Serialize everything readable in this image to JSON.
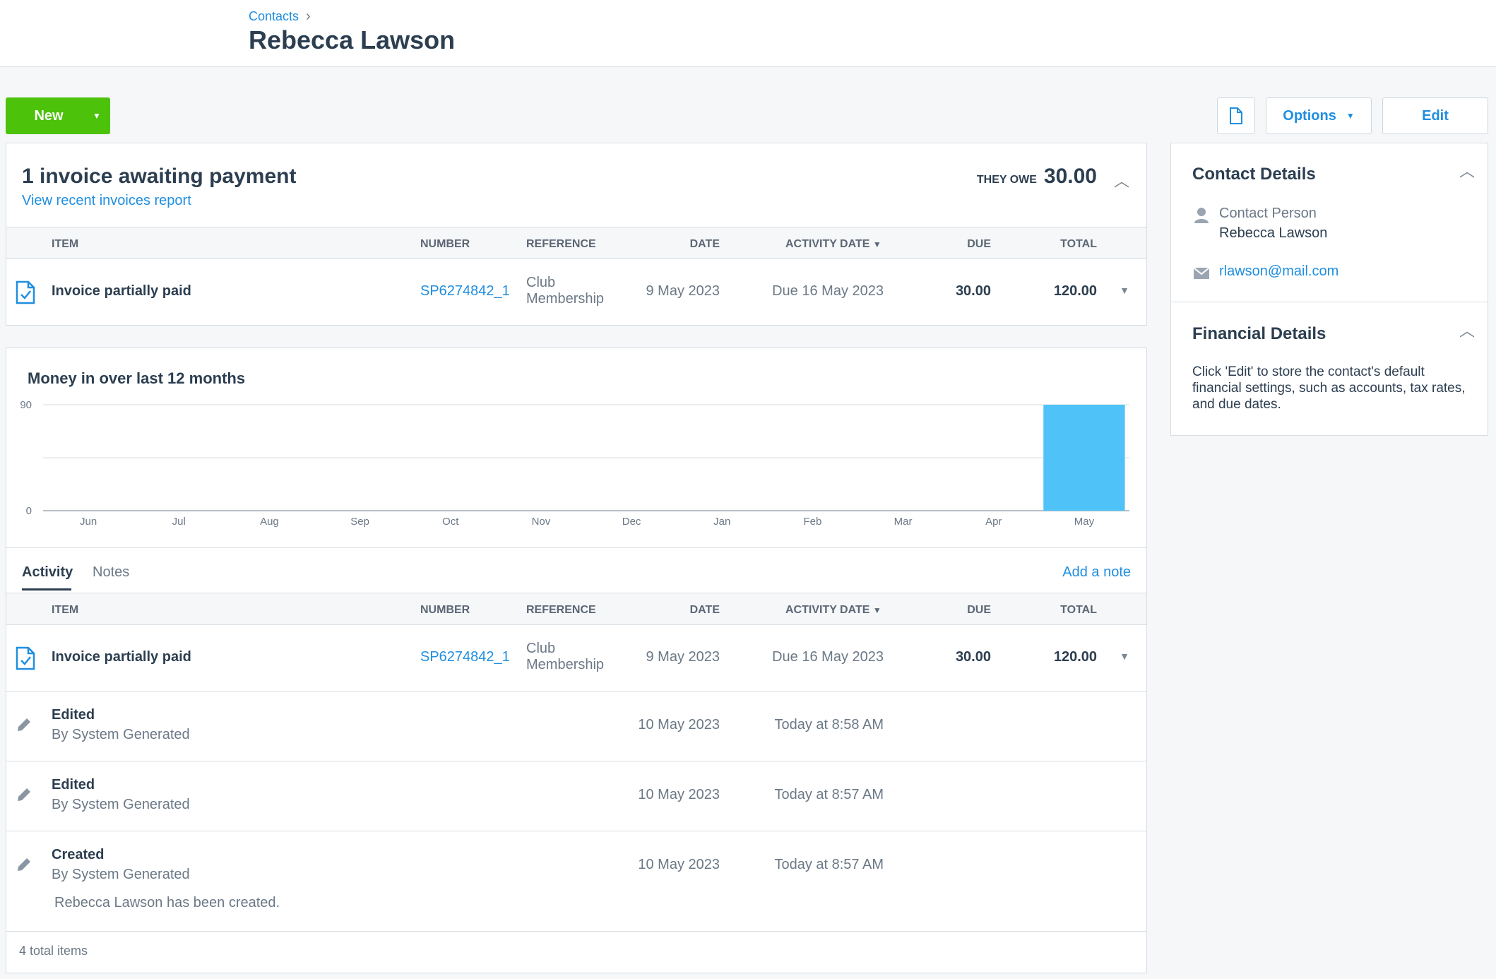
{
  "breadcrumb": {
    "parent": "Contacts",
    "separator": "›"
  },
  "page_title": "Rebecca Lawson",
  "toolbar": {
    "new_label": "New",
    "options_label": "Options",
    "edit_label": "Edit"
  },
  "awaiting": {
    "title": "1 invoice awaiting payment",
    "report_link": "View recent invoices report",
    "they_owe_label": "THEY OWE",
    "they_owe_value": "30.00"
  },
  "table_headers": {
    "item": "ITEM",
    "number": "NUMBER",
    "reference": "REFERENCE",
    "date": "DATE",
    "activity_date": "ACTIVITY DATE",
    "due": "DUE",
    "total": "TOTAL"
  },
  "invoice_row": {
    "title": "Invoice partially paid",
    "number": "SP6274842_1",
    "reference_line1": "Club",
    "reference_line2": "Membership",
    "date": "9 May 2023",
    "activity_date": "Due 16 May 2023",
    "due": "30.00",
    "total": "120.00"
  },
  "chart_data": {
    "type": "bar",
    "title": "Money in over last 12 months",
    "categories": [
      "Jun",
      "Jul",
      "Aug",
      "Sep",
      "Oct",
      "Nov",
      "Dec",
      "Jan",
      "Feb",
      "Mar",
      "Apr",
      "May"
    ],
    "values": [
      0,
      0,
      0,
      0,
      0,
      0,
      0,
      0,
      0,
      0,
      0,
      90
    ],
    "ylim": [
      0,
      90
    ],
    "y_ticks": [
      "0",
      "90"
    ],
    "grid": true,
    "bar_color": "#4fc3f7"
  },
  "tabs": {
    "activity": "Activity",
    "notes": "Notes",
    "add_note": "Add a note"
  },
  "activity": [
    {
      "title": "Edited",
      "by": "By System Generated",
      "date": "10 May 2023",
      "activity_date": "Today at 8:58 AM"
    },
    {
      "title": "Edited",
      "by": "By System Generated",
      "date": "10 May 2023",
      "activity_date": "Today at 8:57 AM"
    },
    {
      "title": "Created",
      "by": "By System Generated",
      "date": "10 May 2023",
      "activity_date": "Today at 8:57 AM",
      "note": "Rebecca Lawson has been created."
    }
  ],
  "total_items": "4 total items",
  "contact_details": {
    "heading": "Contact Details",
    "person_label": "Contact Person",
    "person_name": "Rebecca  Lawson",
    "email": "rlawson@mail.com"
  },
  "financial_details": {
    "heading": "Financial Details",
    "text": "Click 'Edit' to store the contact's default financial settings, such as accounts, tax rates, and due dates."
  },
  "colors": {
    "accent": "#1f8ee0",
    "new_button": "#4cc20a",
    "bar": "#4fc3f7"
  }
}
